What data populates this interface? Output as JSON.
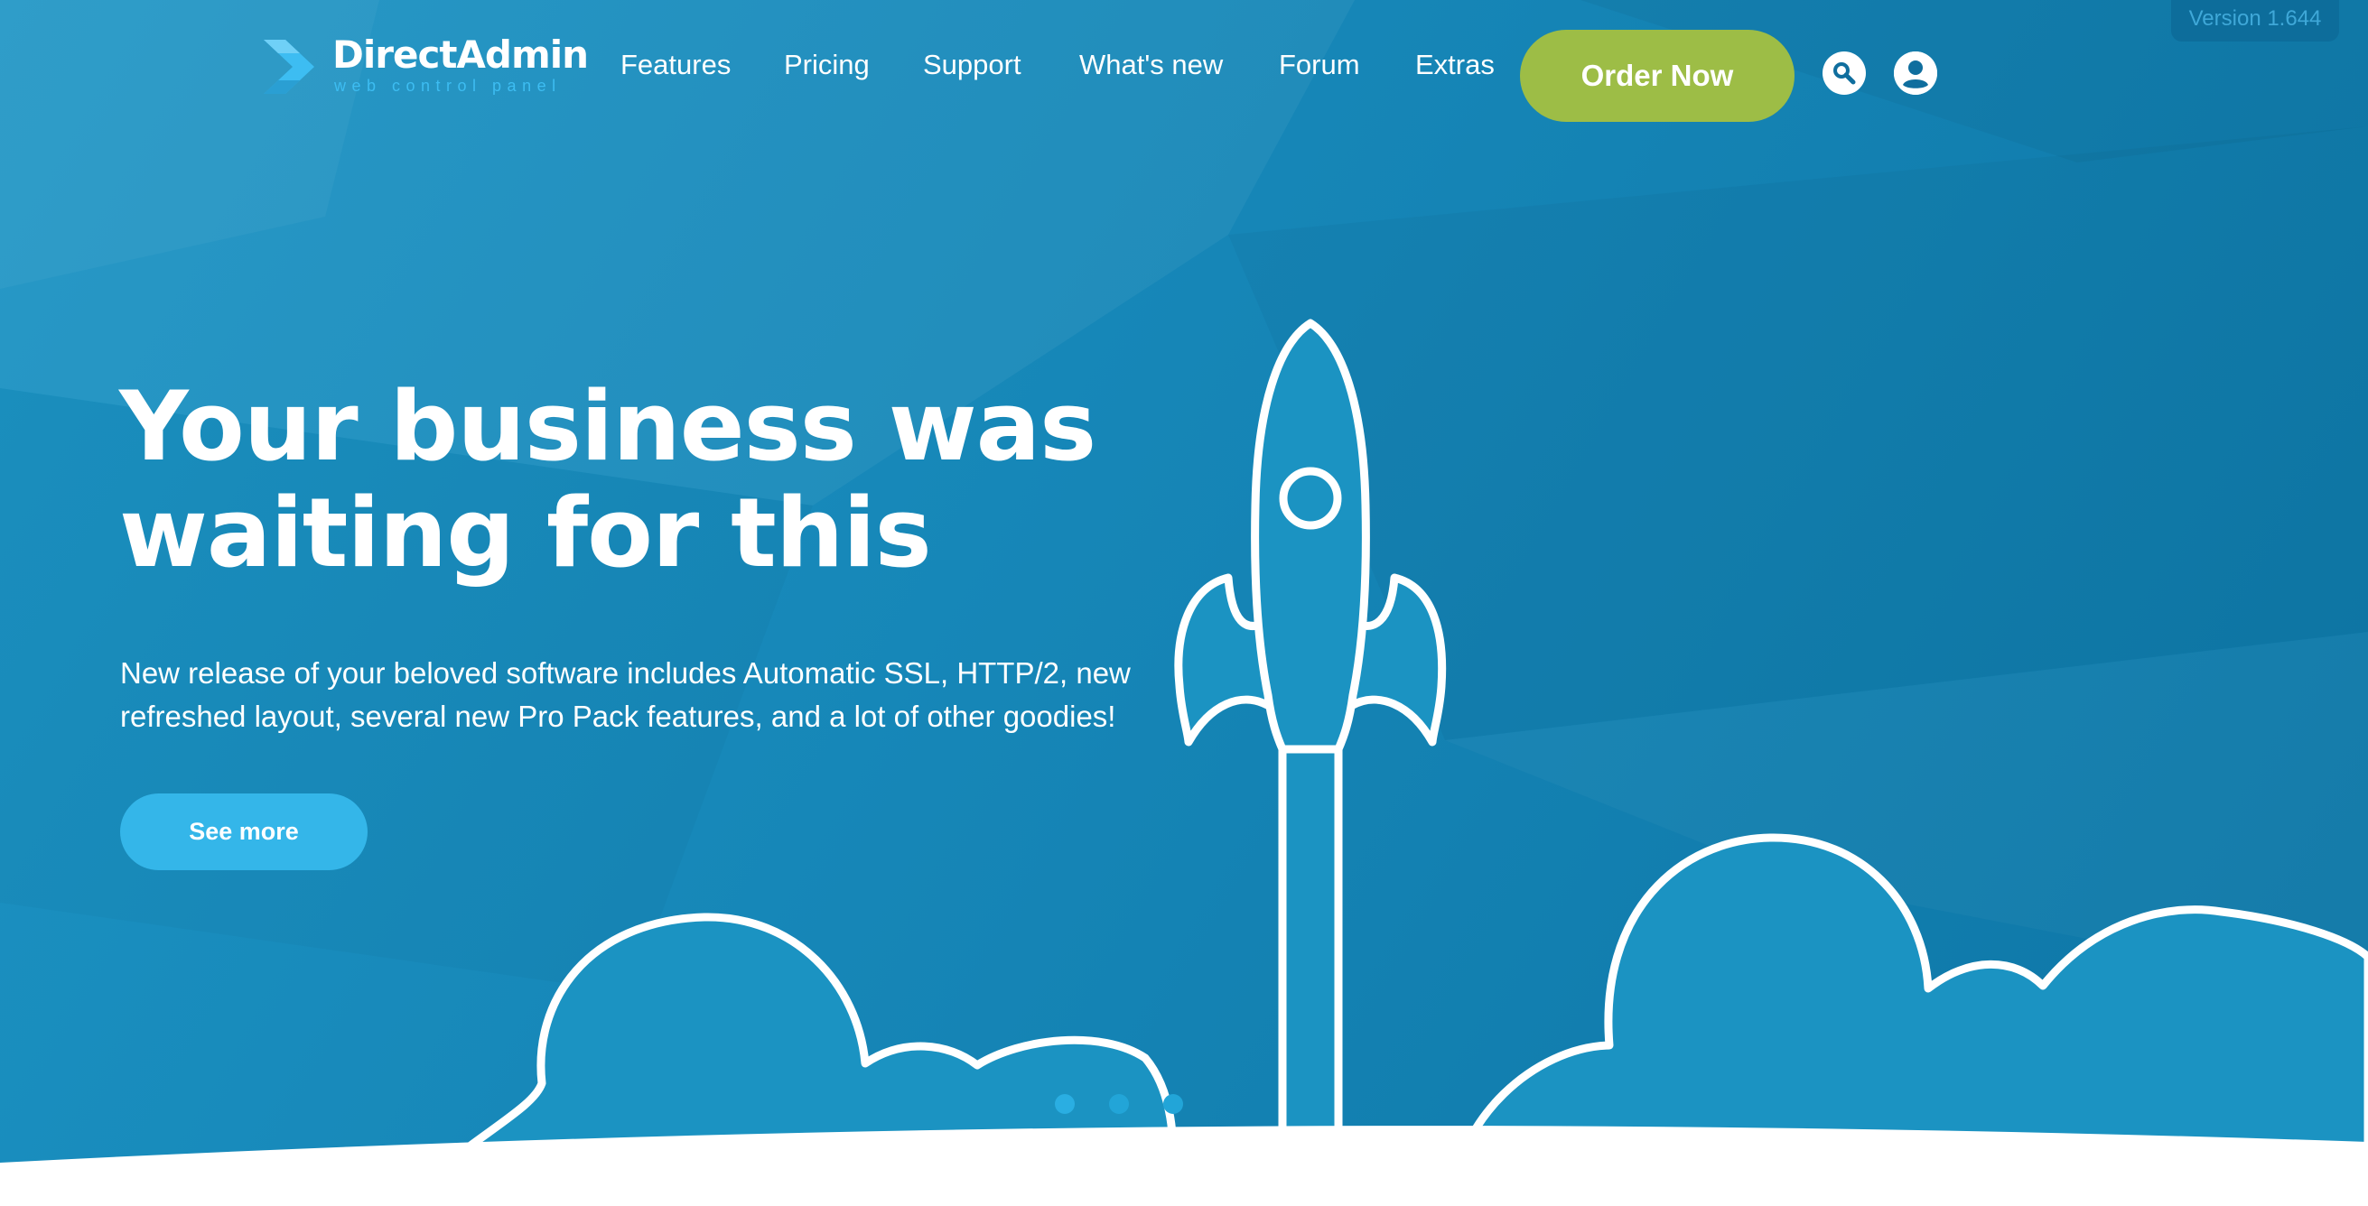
{
  "brand": {
    "name": "DirectAdmin",
    "tagline": "web control panel"
  },
  "nav": {
    "items": [
      "Features",
      "Pricing",
      "Support",
      "What's new",
      "Forum",
      "Extras"
    ],
    "order_button": "Order Now",
    "search_icon": "search-icon",
    "account_icon": "user-account-icon"
  },
  "version": "Version 1.644",
  "hero": {
    "headline": "Your business was waiting for this",
    "subtext": "New release of your beloved software includes Automatic SSL, HTTP/2, new refreshed layout, several new Pro Pack features, and a lot of other goodies!",
    "cta": "See more",
    "illustration": "rocket-launch-illustration",
    "slides_total": 3,
    "slide_active": 1
  },
  "colors": {
    "hero_blue": "#1686b7",
    "accent_green": "#9dbd46",
    "cta_blue": "#34b6e9",
    "logo_blue": "#3dbdf2"
  }
}
